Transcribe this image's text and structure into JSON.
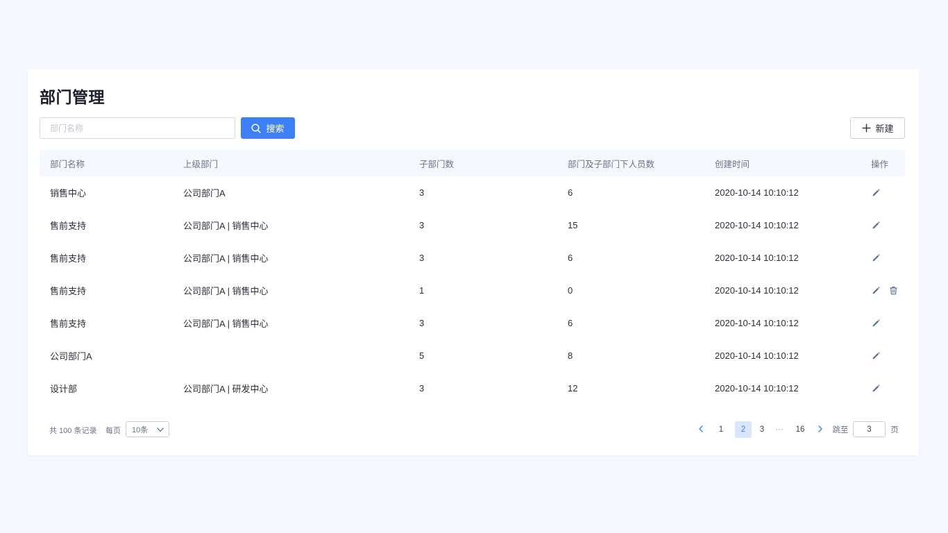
{
  "page": {
    "title": "部门管理"
  },
  "toolbar": {
    "search_placeholder": "部门名称",
    "search_label": "搜索",
    "new_label": "新建"
  },
  "table": {
    "columns": [
      "部门名称",
      "上级部门",
      "子部门数",
      "部门及子部门下人员数",
      "创建时间",
      "操作"
    ],
    "rows": [
      {
        "name": "销售中心",
        "parent": "公司部门A",
        "children": "3",
        "members": "6",
        "created": "2020-10-14  10:10:12",
        "delete": false
      },
      {
        "name": "售前支持",
        "parent": "公司部门A  |  销售中心",
        "children": "3",
        "members": "15",
        "created": "2020-10-14  10:10:12",
        "delete": false
      },
      {
        "name": "售前支持",
        "parent": "公司部门A  |  销售中心",
        "children": "3",
        "members": "6",
        "created": "2020-10-14  10:10:12",
        "delete": false
      },
      {
        "name": "售前支持",
        "parent": "公司部门A  |  销售中心",
        "children": "1",
        "members": "0",
        "created": "2020-10-14  10:10:12",
        "delete": true
      },
      {
        "name": "售前支持",
        "parent": "公司部门A  |  销售中心",
        "children": "3",
        "members": "6",
        "created": "2020-10-14  10:10:12",
        "delete": false
      },
      {
        "name": "公司部门A",
        "parent": "",
        "children": "5",
        "members": "8",
        "created": "2020-10-14  10:10:12",
        "delete": false
      },
      {
        "name": "设计部",
        "parent": "公司部门A  |  研发中心",
        "children": "3",
        "members": "12",
        "created": "2020-10-14  10:10:12",
        "delete": false
      }
    ]
  },
  "footer": {
    "total_text": "共 100 条记录",
    "per_page_label": "每页",
    "per_page_value": "10条",
    "pages": [
      "1",
      "2",
      "3",
      "···",
      "16"
    ],
    "current_page": "2",
    "jump_label": "跳至",
    "jump_value": "3",
    "page_suffix": "页"
  },
  "colors": {
    "accent": "#3d7ff5",
    "background": "#f5f8fd",
    "icon": "#5b6f9a"
  },
  "icons": {
    "search": "search-icon",
    "add": "plus-icon",
    "edit": "pencil-icon",
    "delete": "trash-icon",
    "prev": "chevron-left-icon",
    "next": "chevron-right-icon",
    "dropdown": "chevron-down-icon"
  }
}
